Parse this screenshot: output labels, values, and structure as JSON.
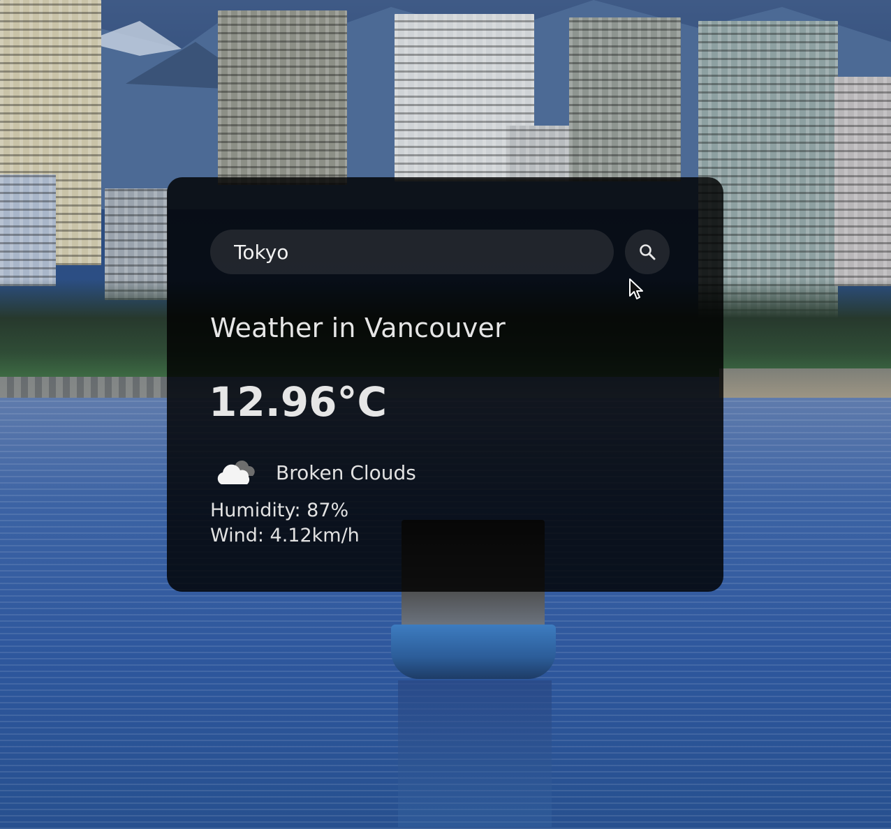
{
  "search": {
    "value": "Tokyo"
  },
  "weather": {
    "title": "Weather in Vancouver",
    "temperature": "12.96°C",
    "condition": "Broken Clouds",
    "condition_icon": "broken-clouds-icon",
    "humidity": "Humidity: 87%",
    "wind": "Wind: 4.12km/h"
  },
  "icons": {
    "search_button": "search-icon"
  },
  "colors": {
    "card_background": "#000000",
    "text": "#e6e6e6",
    "input_background": "#7d7d7d"
  }
}
